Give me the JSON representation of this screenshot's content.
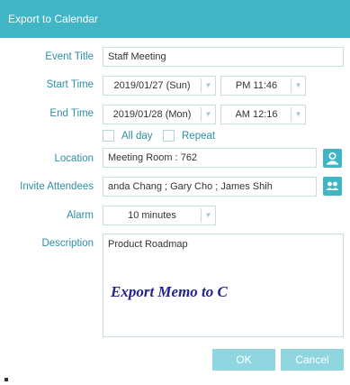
{
  "window": {
    "title": "Export to Calendar"
  },
  "fields": {
    "event_title": {
      "label": "Event Title",
      "value": "Staff Meeting"
    },
    "start_time": {
      "label": "Start Time",
      "date": "2019/01/27 (Sun)",
      "time": "PM 11:46"
    },
    "end_time": {
      "label": "End Time",
      "date": "2019/01/28 (Mon)",
      "time": "AM 12:16"
    },
    "all_day": {
      "label": "All day",
      "checked": false
    },
    "repeat": {
      "label": "Repeat",
      "checked": false
    },
    "location": {
      "label": "Location",
      "value": "Meeting Room : 762"
    },
    "invite_attendees": {
      "label": "Invite Attendees",
      "value": "anda Chang ; Gary Cho ; James Shih"
    },
    "alarm": {
      "label": "Alarm",
      "value": "10 minutes"
    },
    "description": {
      "label": "Description",
      "value": "Product Roadmap"
    }
  },
  "overlay_text": "Export Memo to C",
  "buttons": {
    "ok": "OK",
    "cancel": "Cancel"
  },
  "icons": {
    "location_picker": "person-pin-icon",
    "attendees_picker": "people-icon",
    "dropdown": "chevron-down-icon"
  },
  "colors": {
    "accent": "#3fb5c6",
    "label": "#2d8fa3",
    "button": "#8fd6e0",
    "overlay": "#24238a"
  }
}
